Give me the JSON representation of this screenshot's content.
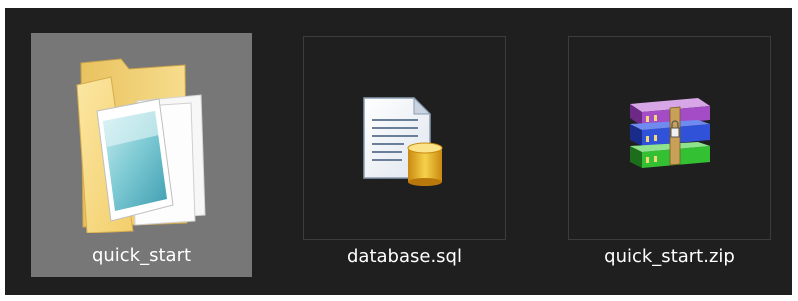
{
  "explorer": {
    "items": [
      {
        "name": "quick_start",
        "type": "folder",
        "icon": "folder-icon",
        "selected": true
      },
      {
        "name": "database.sql",
        "type": "sql",
        "icon": "sql-file-icon",
        "selected": false
      },
      {
        "name": "quick_start.zip",
        "type": "archive",
        "icon": "winrar-archive-icon",
        "selected": false
      }
    ]
  },
  "colors": {
    "background": "#1f1f1f",
    "selection": "#777777",
    "text": "#ffffff"
  }
}
